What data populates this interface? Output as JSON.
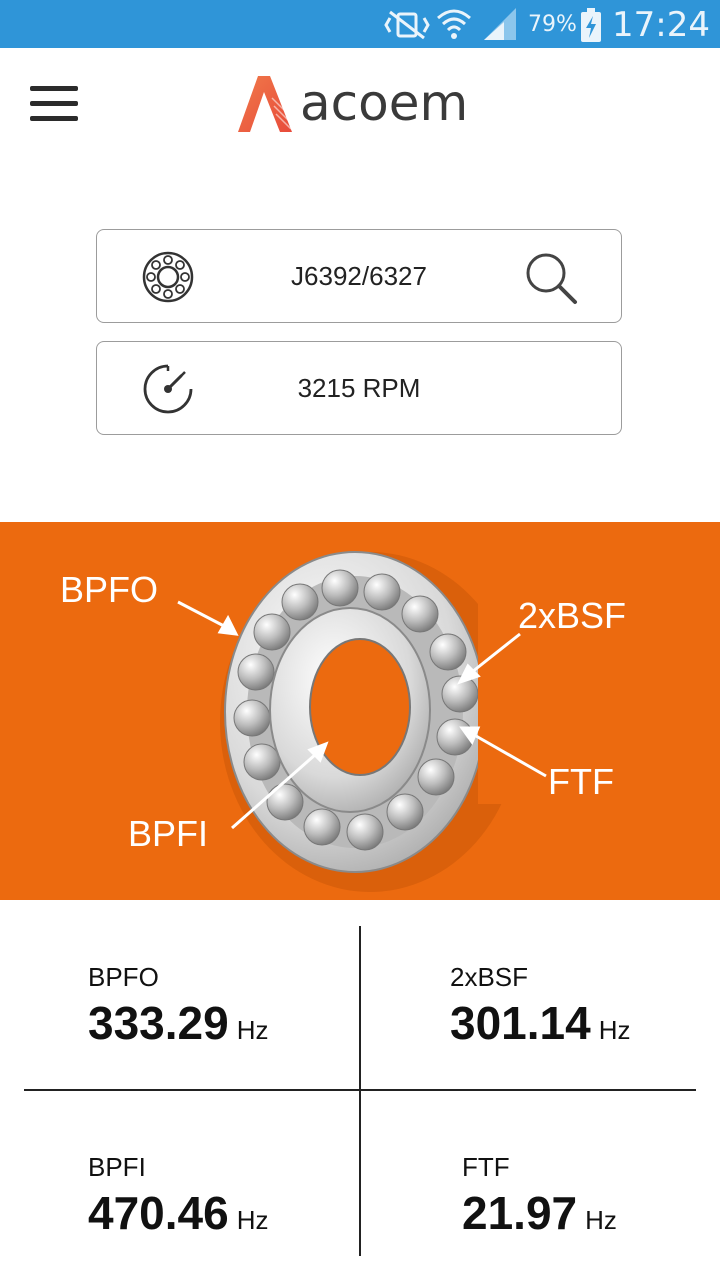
{
  "status_bar": {
    "battery_percent": "79%",
    "time": "17:24",
    "icons": [
      "mute-vibrate-icon",
      "wifi-icon",
      "signal-icon",
      "battery-charging-icon"
    ]
  },
  "app_bar": {
    "menu_icon": "hamburger-menu-icon",
    "logo_text": "acoem"
  },
  "bearing_field": {
    "icon": "bearing-icon",
    "value": "J6392/6327",
    "action_icon": "search-icon"
  },
  "speed_field": {
    "icon": "speedometer-icon",
    "value": "3215 RPM"
  },
  "diagram": {
    "background": "#ec6a0f",
    "labels": {
      "bpfo": "BPFO",
      "bsf": "2xBSF",
      "ftf": "FTF",
      "bpfi": "BPFI"
    }
  },
  "results": [
    {
      "label": "BPFO",
      "value": "333.29",
      "unit": "Hz"
    },
    {
      "label": "2xBSF",
      "value": "301.14",
      "unit": "Hz"
    },
    {
      "label": "BPFI",
      "value": "470.46",
      "unit": "Hz"
    },
    {
      "label": "FTF",
      "value": "21.97",
      "unit": "Hz"
    }
  ],
  "colors": {
    "status_bar": "#2f95d8",
    "accent": "#ec6a0f",
    "logo_accent": "#ee5a3c"
  }
}
